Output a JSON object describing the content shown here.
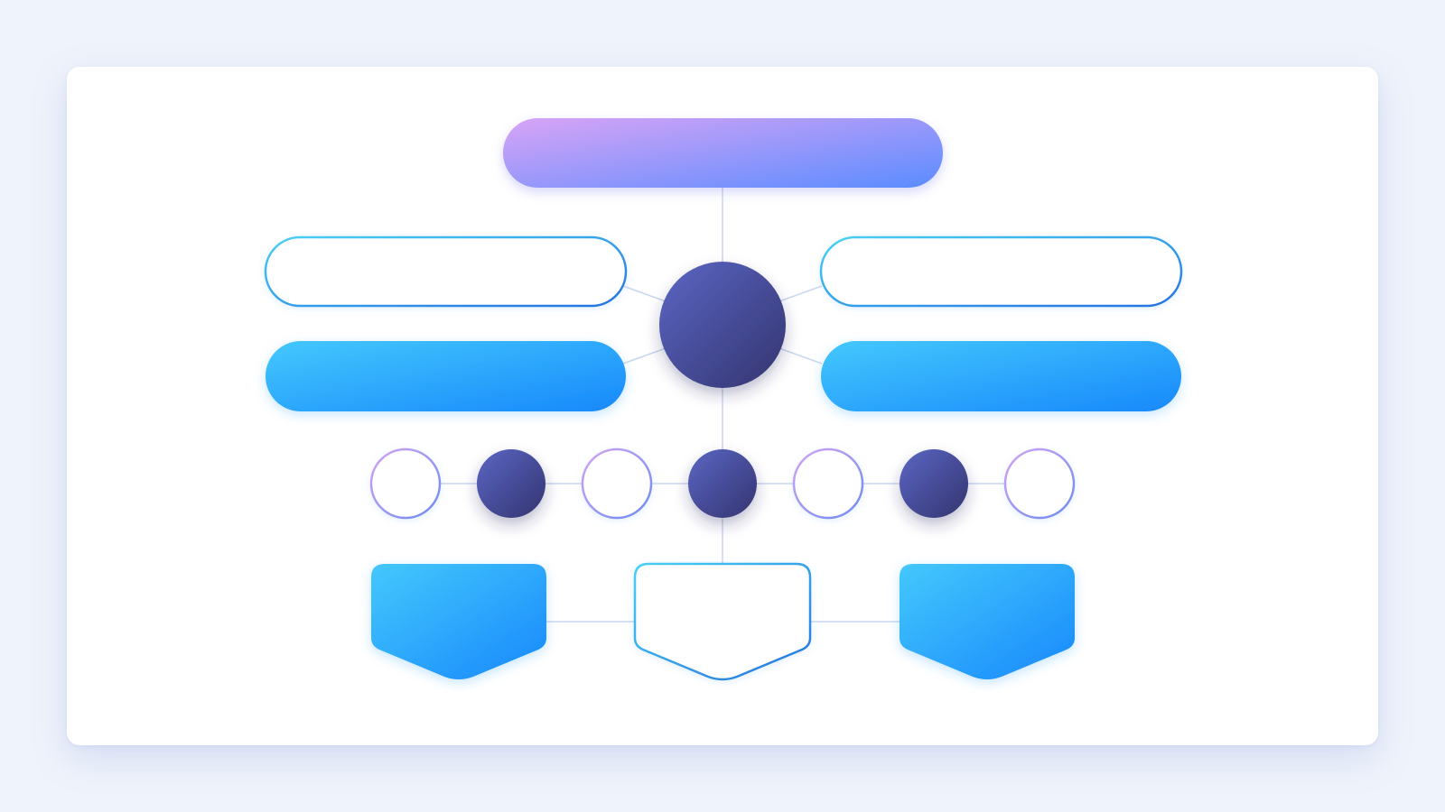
{
  "diagram": {
    "title": "",
    "top_bar": {
      "label": ""
    },
    "hub": {
      "label": ""
    },
    "left_outline_bar": {
      "label": ""
    },
    "left_filled_bar": {
      "label": ""
    },
    "right_outline_bar": {
      "label": ""
    },
    "right_filled_bar": {
      "label": ""
    },
    "step_circles": [
      {
        "style": "outline",
        "label": ""
      },
      {
        "style": "filled",
        "label": ""
      },
      {
        "style": "outline",
        "label": ""
      },
      {
        "style": "filled",
        "label": ""
      },
      {
        "style": "outline",
        "label": ""
      },
      {
        "style": "filled",
        "label": ""
      },
      {
        "style": "outline",
        "label": ""
      }
    ],
    "bottom_tags": [
      {
        "style": "filled",
        "label": ""
      },
      {
        "style": "outline",
        "label": ""
      },
      {
        "style": "filled",
        "label": ""
      }
    ]
  },
  "colors": {
    "background": "#eff3fb",
    "card": "#ffffff",
    "gradient_purple": "#d8a4f6",
    "gradient_blue": "#5a8cff",
    "cyan_start": "#44c8fd",
    "cyan_end": "#1788fb",
    "hub_light": "#5964c0",
    "hub_dark": "#343672",
    "connector": "#c9d6ee",
    "outline_cyan": "#43c6f5",
    "outline_blue": "#2a7de6",
    "outline_violet": "#c6a0ee"
  }
}
